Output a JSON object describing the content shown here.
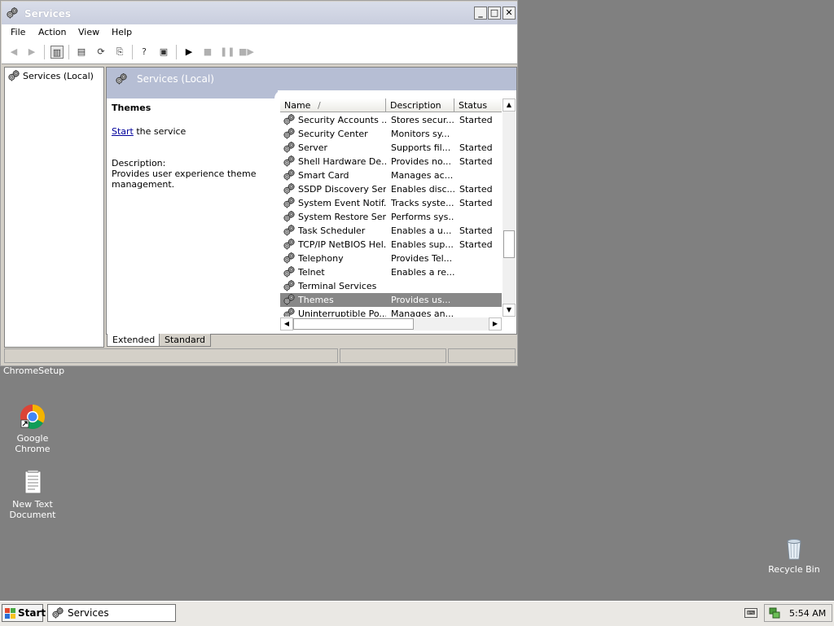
{
  "window": {
    "title": "Services",
    "min_label": "_",
    "max_label": "□",
    "close_label": "✕"
  },
  "menu": [
    "File",
    "Action",
    "View",
    "Help"
  ],
  "tree": {
    "root": "Services (Local)"
  },
  "banner": {
    "title": "Services (Local)"
  },
  "details": {
    "service_name": "Themes",
    "start_link": "Start",
    "start_suffix": " the service",
    "description_label": "Description:",
    "description_text": "Provides user experience theme management."
  },
  "list": {
    "columns": [
      "Name",
      "Description",
      "Status"
    ],
    "sort_indicator": "/",
    "rows": [
      {
        "name": "Security Accounts ...",
        "description": "Stores secur...",
        "status": "Started",
        "selected": false
      },
      {
        "name": "Security Center",
        "description": "Monitors sy...",
        "status": "",
        "selected": false
      },
      {
        "name": "Server",
        "description": "Supports fil...",
        "status": "Started",
        "selected": false
      },
      {
        "name": "Shell Hardware De...",
        "description": "Provides no...",
        "status": "Started",
        "selected": false
      },
      {
        "name": "Smart Card",
        "description": "Manages ac...",
        "status": "",
        "selected": false
      },
      {
        "name": "SSDP Discovery Ser...",
        "description": "Enables disc...",
        "status": "Started",
        "selected": false
      },
      {
        "name": "System Event Notif...",
        "description": "Tracks syste...",
        "status": "Started",
        "selected": false
      },
      {
        "name": "System Restore Ser...",
        "description": "Performs sys...",
        "status": "",
        "selected": false
      },
      {
        "name": "Task Scheduler",
        "description": "Enables a u...",
        "status": "Started",
        "selected": false
      },
      {
        "name": "TCP/IP NetBIOS Hel...",
        "description": "Enables sup...",
        "status": "Started",
        "selected": false
      },
      {
        "name": "Telephony",
        "description": "Provides Tel...",
        "status": "",
        "selected": false
      },
      {
        "name": "Telnet",
        "description": "Enables a re...",
        "status": "",
        "selected": false
      },
      {
        "name": "Terminal Services",
        "description": "",
        "status": "",
        "selected": false
      },
      {
        "name": "Themes",
        "description": "Provides us...",
        "status": "",
        "selected": true
      },
      {
        "name": "Uninterruptible Po...",
        "description": "Manages an...",
        "status": "",
        "selected": false
      }
    ]
  },
  "tabs": [
    "Extended",
    "Standard"
  ],
  "desktop": {
    "chrome_setup_label": "ChromeSetup",
    "chrome_label": "Google Chrome",
    "textdoc_label": "New Text Document",
    "recycle_label": "Recycle Bin"
  },
  "taskbar": {
    "start_label": "Start",
    "task_label": "Services",
    "clock": "5:54 AM"
  }
}
